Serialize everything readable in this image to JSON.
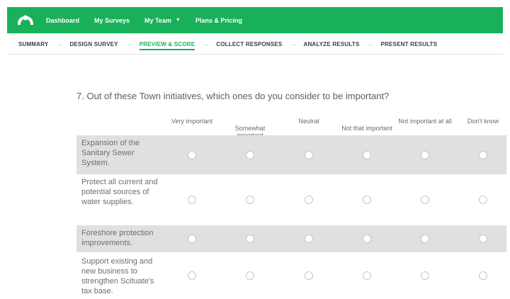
{
  "nav": {
    "items": [
      {
        "label": "Dashboard"
      },
      {
        "label": "My Surveys"
      },
      {
        "label": "My Team",
        "has_caret": true
      },
      {
        "label": "Plans & Pricing"
      }
    ]
  },
  "steps": [
    {
      "label": "SUMMARY",
      "active": false
    },
    {
      "label": "DESIGN SURVEY",
      "active": false
    },
    {
      "label": "PREVIEW & SCORE",
      "active": true
    },
    {
      "label": "COLLECT RESPONSES",
      "active": false
    },
    {
      "label": "ANALYZE RESULTS",
      "active": false
    },
    {
      "label": "PRESENT RESULTS",
      "active": false
    }
  ],
  "question": {
    "text": "7. Out of these Town initiatives, which ones do you consider to be important?",
    "columns": [
      "Very important",
      "Somewhat important",
      "Neutral",
      "Not that important",
      "Not important at all",
      "Don't know"
    ],
    "rows": [
      {
        "label": "Expansion of the Sanitary Sewer System.",
        "shaded": true
      },
      {
        "label": "Protect all current and potential sources of water supplies.",
        "shaded": false
      },
      {
        "label": "Foreshore protection improvements.",
        "shaded": true
      },
      {
        "label": "Support existing and new business to strengthen Scituate's tax base.",
        "shaded": false
      }
    ]
  },
  "colors": {
    "brand": "#19b05a",
    "row_shade": "#e0e0e0"
  }
}
